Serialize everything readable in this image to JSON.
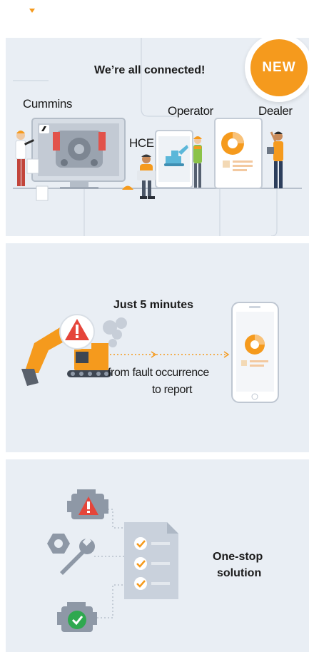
{
  "badge": {
    "label": "NEW"
  },
  "panel_connected": {
    "title": "We’re all connected!",
    "labels": {
      "cummins": "Cummins",
      "operator": "Operator",
      "dealer": "Dealer",
      "hce": "HCE"
    }
  },
  "panel_minutes": {
    "title": "Just 5 minutes",
    "caption_line1": "from fault occurrence",
    "caption_line2": "to report"
  },
  "panel_onestop": {
    "line1": "One-stop",
    "line2": "solution"
  },
  "colors": {
    "accent": "#f59a1d",
    "panel_bg": "#e9eef4",
    "alert_red": "#e5453a",
    "ok_green": "#2fa84f",
    "machine_gray": "#8e98a6"
  },
  "icons": [
    "engine-icon",
    "warning-icon",
    "wrench-icon",
    "nut-icon",
    "checklist-icon",
    "checkmark-icon",
    "excavator-icon",
    "phone-icon",
    "tablet-icon",
    "monitor-icon",
    "person-icon"
  ]
}
